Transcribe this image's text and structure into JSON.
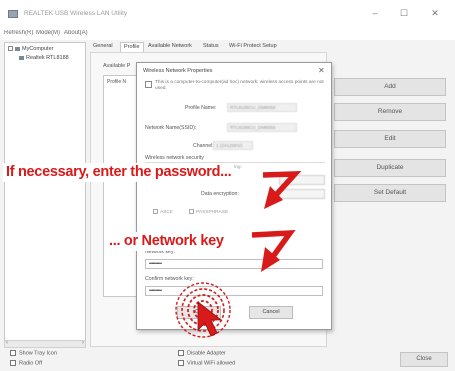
{
  "window": {
    "title": "REALTEK USB Wireless LAN Utility",
    "controls": {
      "minimize": "–",
      "maximize": "☐",
      "close": "✕"
    }
  },
  "menu": [
    "Refresh(R)",
    "Mode(M)",
    "About(A)"
  ],
  "tree": {
    "root": "MyComputer",
    "child": "Realtek RTL8188"
  },
  "tabs": [
    "General",
    "Profile",
    "Available Network",
    "Status",
    "Wi-Fi Protect Setup"
  ],
  "active_tab": "Profile",
  "panel": {
    "available_label": "Available P",
    "list_header": "Profile N"
  },
  "side_buttons": [
    "Add",
    "Remove",
    "Edit",
    "Duplicate",
    "Set Default"
  ],
  "dialog": {
    "title": "Wireless Network Properties",
    "close": "✕",
    "note": "This is a computer-to-computer(ad hoc) network; wireless access points are not used.",
    "profile_name_label": "Profile Name:",
    "profile_name_value": "RTL8188CU_DM8058",
    "ssid_label": "Network Name(SSID):",
    "ssid_value": "RTL8188CU_DM8058",
    "channel_label": "Channel:",
    "channel_value": "1 (2412MHz)",
    "security_label": "Wireless network security",
    "security_desc": "This network requires a key for the following:",
    "auth_label": "Network Authentication:",
    "encryption_label": "Data encryption:",
    "aes_label": "ASCII",
    "passphrase_label": "PASSPHRASE",
    "key_index_label": "Key index (advanced):",
    "key_index_value": "1",
    "network_key_label": "Network key:",
    "network_key_value": "••••••••••",
    "confirm_key_label": "Confirm network key:",
    "confirm_key_value": "••••••••••",
    "ok_label": "OK",
    "cancel_label": "Cancel"
  },
  "bottom": {
    "show_tray_icon": "Show Tray Icon",
    "radio_off": "Radio Off",
    "disable_adapter": "Disable Adapter",
    "virtual_wifi": "Virtual WiFi allowed",
    "close": "Close"
  },
  "annotations": {
    "password_hint": "If necessary, enter the password...",
    "network_key_hint": "... or Network key"
  },
  "colors": {
    "annotation": "#d91a1a"
  }
}
